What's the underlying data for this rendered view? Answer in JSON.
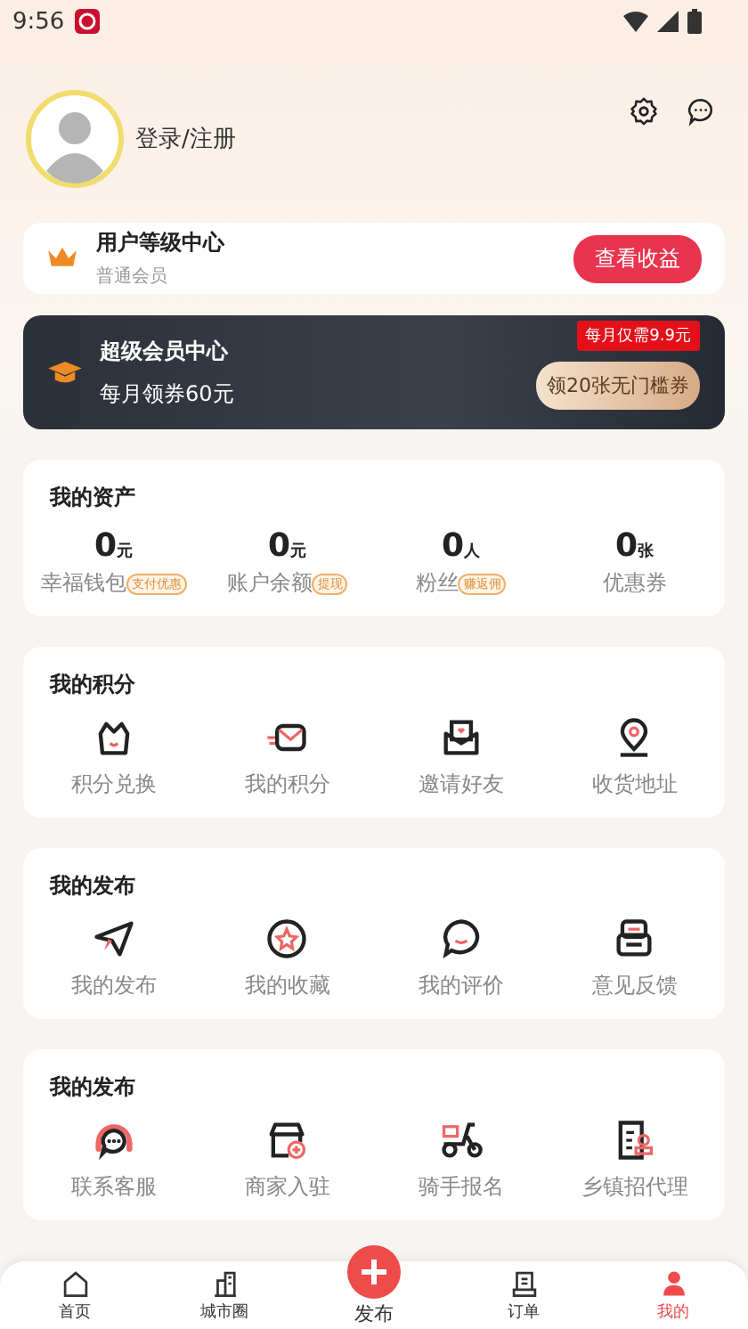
{
  "status_bar": {
    "time": "9:56"
  },
  "profile": {
    "login": "登录/注册"
  },
  "level_card": {
    "title": "用户等级中心",
    "subtitle": "普通会员",
    "button": "查看收益"
  },
  "vip_card": {
    "title": "超级会员中心",
    "subtitle": "每月领券60元",
    "badge": "每月仅需9.9元",
    "button": "领20张无门槛券"
  },
  "assets": {
    "title": "我的资产",
    "items": [
      {
        "value": "0",
        "unit": "元",
        "label": "幸福钱包",
        "tag": "支付优惠"
      },
      {
        "value": "0",
        "unit": "元",
        "label": "账户余额",
        "tag": "提现"
      },
      {
        "value": "0",
        "unit": "人",
        "label": "粉丝",
        "tag": "赚返佣"
      },
      {
        "value": "0",
        "unit": "张",
        "label": "优惠券"
      }
    ]
  },
  "sections": [
    {
      "title": "我的积分",
      "items": [
        "积分兑换",
        "我的积分",
        "邀请好友",
        "收货地址"
      ]
    },
    {
      "title": "我的发布",
      "items": [
        "我的发布",
        "我的收藏",
        "我的评价",
        "意见反馈"
      ]
    },
    {
      "title": "我的发布",
      "items": [
        "联系客服",
        "商家入驻",
        "骑手报名",
        "乡镇招代理"
      ]
    }
  ],
  "tab_bar": [
    {
      "label": "首页",
      "selected": false,
      "kind": "normal"
    },
    {
      "label": "城市圈",
      "selected": false,
      "kind": "normal"
    },
    {
      "label": "发布",
      "selected": false,
      "kind": "center"
    },
    {
      "label": "订单",
      "selected": false,
      "kind": "normal"
    },
    {
      "label": "我的",
      "selected": true,
      "kind": "normal"
    }
  ]
}
